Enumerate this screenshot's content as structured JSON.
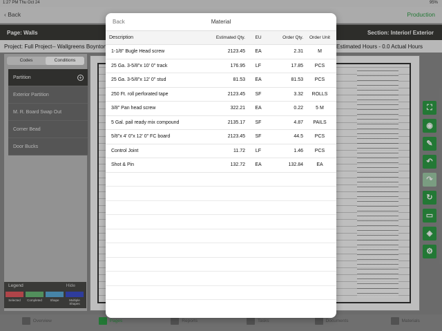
{
  "status": {
    "time": "1:27 PM  Thu Oct 24",
    "battery": "95%"
  },
  "nav": {
    "back_label": "Back",
    "mode_label": "Production"
  },
  "page_bar": {
    "page": "Page: Walls",
    "section": "Section: Interior/ Exterior"
  },
  "project_bar": {
    "project": "Project:  Full Project-- Wallgreens Boynton",
    "hours": "Estimated Hours - 0.0 Actual Hours"
  },
  "left_panel": {
    "tabs": [
      "Codes",
      "Conditions"
    ],
    "conditions": [
      "Partition",
      "Exterior Partition",
      "M. R. Board Swap Out",
      "Corner Bead",
      "Door Bucks"
    ],
    "legend": {
      "title": "Legend",
      "hide_label": "Hide",
      "items": [
        {
          "label": "Selected",
          "color": "#e0585e"
        },
        {
          "label": "Completed",
          "color": "#69b876"
        },
        {
          "label": "Shape",
          "color": "#5aa9d6"
        },
        {
          "label": "Multiple Shapes",
          "color": "#3b4dc8"
        }
      ]
    }
  },
  "tools": [
    "expand-icon",
    "camera-icon",
    "comment-icon",
    "undo-icon",
    "redo-icon",
    "refresh-icon",
    "measure-icon",
    "layers-icon",
    "settings-icon"
  ],
  "tabbar": {
    "tabs": [
      {
        "label": "Overview",
        "icon": "bar-chart-icon",
        "active": false
      },
      {
        "label": "Pages",
        "icon": "pages-icon",
        "active": true
      },
      {
        "label": "Reports",
        "icon": "reports-icon",
        "active": false
      },
      {
        "label": "Tasks",
        "icon": "tasks-icon",
        "active": false
      },
      {
        "label": "Documents",
        "icon": "documents-icon",
        "active": false
      },
      {
        "label": "Materials",
        "icon": "materials-icon",
        "active": false
      }
    ]
  },
  "modal": {
    "back_label": "Back",
    "title": "Material",
    "columns": {
      "description": "Description",
      "estimated_qty": "Estimated Qty.",
      "eu": "EU",
      "order_qty": "Order Qty.",
      "order_unit": "Order Unit"
    },
    "rows": [
      {
        "description": "1-1/8\"  Bugle Head screw",
        "estimated_qty": "2123.45",
        "eu": "EA",
        "order_qty": "2.31",
        "order_unit": "M"
      },
      {
        "description": "25 Ga. 3-5/8\"x 10' 0\"  track",
        "estimated_qty": "176.95",
        "eu": "LF",
        "order_qty": "17.85",
        "order_unit": "PCS"
      },
      {
        "description": "25 Ga. 3-5/8\"x 12' 0\"  stud",
        "estimated_qty": "81.53",
        "eu": "EA",
        "order_qty": "81.53",
        "order_unit": "PCS"
      },
      {
        "description": "250 Ft. roll perforated tape",
        "estimated_qty": "2123.45",
        "eu": "SF",
        "order_qty": "3.32",
        "order_unit": "ROLLS"
      },
      {
        "description": "3/8\" Pan head screw",
        "estimated_qty": "322.21",
        "eu": "EA",
        "order_qty": "0.22",
        "order_unit": "5 M"
      },
      {
        "description": "5 Gal. pail ready mix compound",
        "estimated_qty": "2135.17",
        "eu": "SF",
        "order_qty": "4.87",
        "order_unit": "PAILS"
      },
      {
        "description": "5/8\"x 4' 0\"x 12' 0\" FC board",
        "estimated_qty": "2123.45",
        "eu": "SF",
        "order_qty": "44.5",
        "order_unit": "PCS"
      },
      {
        "description": "Control Joint",
        "estimated_qty": "11.72",
        "eu": "LF",
        "order_qty": "1.46",
        "order_unit": "PCS"
      },
      {
        "description": "Shot & Pin",
        "estimated_qty": "132.72",
        "eu": "EA",
        "order_qty": "132.84",
        "order_unit": "EA"
      }
    ]
  }
}
